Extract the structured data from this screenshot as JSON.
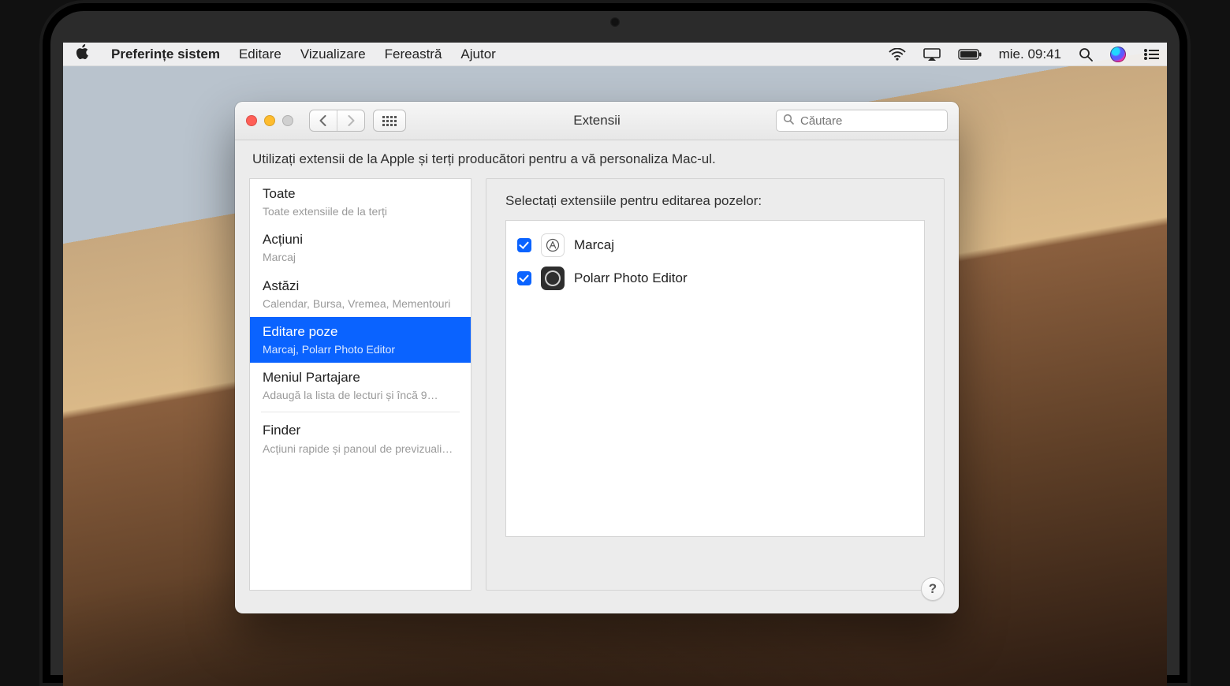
{
  "menubar": {
    "app_name": "Preferințe sistem",
    "menus": [
      "Editare",
      "Vizualizare",
      "Fereastră",
      "Ajutor"
    ],
    "clock": "mie. 09:41"
  },
  "window": {
    "title": "Extensii",
    "search_placeholder": "Căutare",
    "description": "Utilizați extensii de la Apple și terți producători pentru a vă personaliza Mac-ul.",
    "selected_index": 3,
    "sidebar": [
      {
        "title": "Toate",
        "subtitle": "Toate extensiile de la terți"
      },
      {
        "title": "Acțiuni",
        "subtitle": "Marcaj"
      },
      {
        "title": "Astăzi",
        "subtitle": "Calendar, Bursa, Vremea, Mementouri"
      },
      {
        "title": "Editare poze",
        "subtitle": "Marcaj, Polarr Photo Editor"
      },
      {
        "title": "Meniul Partajare",
        "subtitle": "Adaugă la lista de lecturi și încă 9…"
      },
      {
        "title": "Finder",
        "subtitle": "Acțiuni rapide și panoul de previzuali…",
        "separated": true
      }
    ],
    "detail": {
      "heading": "Selectați extensiile pentru editarea pozelor:",
      "extensions": [
        {
          "name": "Marcaj",
          "checked": true,
          "icon": "markup-icon"
        },
        {
          "name": "Polarr Photo Editor",
          "checked": true,
          "icon": "polarr-icon"
        }
      ]
    },
    "help_label": "?"
  }
}
